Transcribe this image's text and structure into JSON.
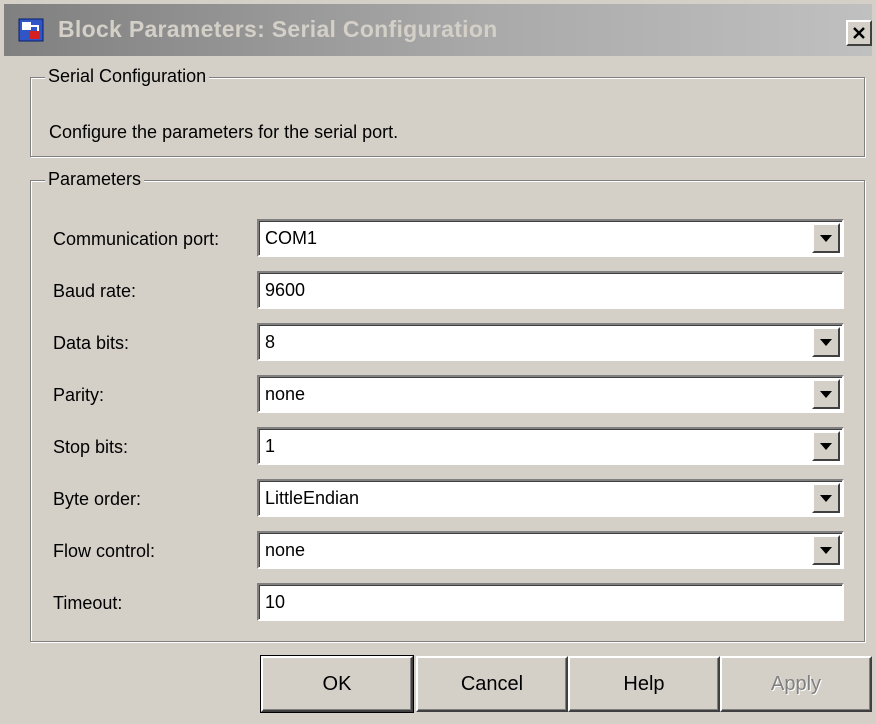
{
  "window": {
    "title": "Block Parameters: Serial Configuration",
    "close_glyph": "✕"
  },
  "description_group": {
    "title": "Serial Configuration",
    "text": "Configure the parameters for the serial port."
  },
  "parameters_group": {
    "title": "Parameters",
    "fields": [
      {
        "label": "Communication port:",
        "value": "COM1",
        "type": "dropdown"
      },
      {
        "label": "Baud rate:",
        "value": "9600",
        "type": "text"
      },
      {
        "label": "Data bits:",
        "value": "8",
        "type": "dropdown"
      },
      {
        "label": "Parity:",
        "value": "none",
        "type": "dropdown"
      },
      {
        "label": "Stop bits:",
        "value": "1",
        "type": "dropdown"
      },
      {
        "label": "Byte order:",
        "value": "LittleEndian",
        "type": "dropdown"
      },
      {
        "label": "Flow control:",
        "value": "none",
        "type": "dropdown"
      },
      {
        "label": "Timeout:",
        "value": "10",
        "type": "text"
      }
    ]
  },
  "buttons": {
    "ok": "OK",
    "cancel": "Cancel",
    "help": "Help",
    "apply": "Apply"
  },
  "colors": {
    "face": "#d4d0c8",
    "title_inactive_start": "#808080",
    "title_inactive_end": "#c0c0c0"
  }
}
